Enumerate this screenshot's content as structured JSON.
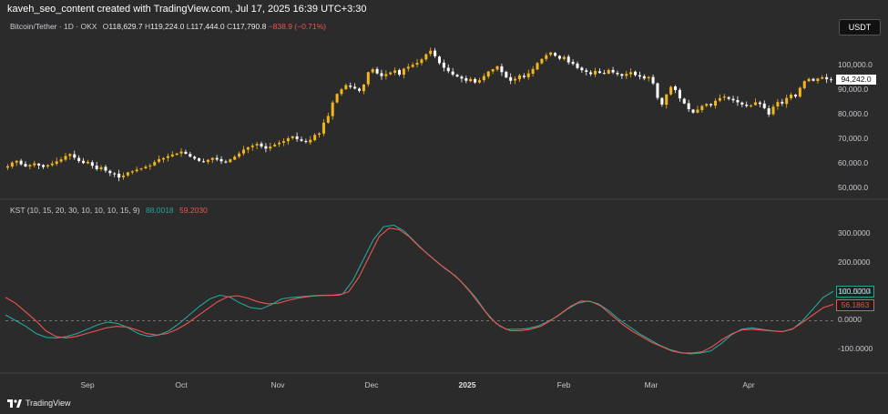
{
  "header": {
    "credit": "kaveh_seo_content created with TradingView.com, Jul 17, 2025 16:39 UTC+3:30",
    "symbol": "Bitcoin/Tether · 1D · OKX",
    "o_label": "O",
    "o_value": "118,629.7",
    "h_label": "H",
    "h_value": "119,224.0",
    "l_label": "L",
    "l_value": "117,444.0",
    "c_label": "C",
    "c_value": "117,790.8",
    "change": "−838.9 (−0.71%)",
    "currency": "USDT"
  },
  "kst": {
    "label": "KST (10, 15, 20, 30, 10, 10, 10, 15, 9)",
    "value1": "88.0018",
    "value2": "59.2030"
  },
  "footer": {
    "brand": "TradingView"
  },
  "colors": {
    "up": "#f2b51d",
    "down": "#ffffff",
    "kst": "#26a69a",
    "signal": "#ef5350",
    "background": "#2b2b2b"
  },
  "chart_data": [
    {
      "type": "candlestick",
      "ylim": [
        47000,
        112000
      ],
      "y_ticks": [
        "100,000.0",
        "90,000.0",
        "80,000.0",
        "70,000.0",
        "60,000.0",
        "50,000.0"
      ],
      "last_price_label": "94,242.0",
      "x_ticks": [
        "Sep",
        "Oct",
        "Nov",
        "Dec",
        "2025",
        "Feb",
        "Mar",
        "Apr"
      ],
      "closes": [
        59000,
        60500,
        61200,
        59800,
        58900,
        59500,
        60200,
        59300,
        58700,
        59400,
        60100,
        61000,
        61800,
        63200,
        64000,
        62500,
        61100,
        60300,
        60800,
        59200,
        57800,
        58600,
        57200,
        56200,
        55800,
        54400,
        55200,
        56500,
        56900,
        57600,
        58100,
        58800,
        59300,
        60700,
        61900,
        62300,
        63100,
        63800,
        64200,
        65000,
        64100,
        62900,
        62100,
        61200,
        60800,
        61600,
        62400,
        61700,
        61000,
        60500,
        61800,
        62900,
        64200,
        65800,
        66700,
        67400,
        68100,
        67100,
        66200,
        67000,
        67800,
        68600,
        69200,
        70400,
        71200,
        70100,
        69400,
        68900,
        69800,
        71800,
        72400,
        76800,
        79500,
        85000,
        88500,
        90400,
        92100,
        91400,
        90700,
        89800,
        92300,
        97400,
        98600,
        96900,
        95800,
        96600,
        97300,
        98100,
        96400,
        98800,
        99600,
        100400,
        101200,
        102600,
        104700,
        106200,
        103900,
        101100,
        99200,
        97800,
        96400,
        95600,
        94800,
        93900,
        94600,
        93200,
        94100,
        95800,
        97700,
        98600,
        99800,
        97400,
        95200,
        93900,
        94700,
        96100,
        95400,
        96900,
        98700,
        101100,
        102800,
        104300,
        105400,
        104100,
        102900,
        103600,
        101400,
        100800,
        99100,
        98200,
        97500,
        96600,
        97900,
        97100,
        96800,
        98300,
        97300,
        96600,
        95900,
        96700,
        97400,
        96200,
        95600,
        94800,
        95400,
        92800,
        86900,
        84200,
        88300,
        91400,
        90100,
        86700,
        84600,
        82300,
        80900,
        82100,
        83600,
        84400,
        83900,
        85700,
        86800,
        87400,
        86500,
        85900,
        85100,
        84200,
        83600,
        83800,
        85100,
        84400,
        82700,
        80100,
        83300,
        85200,
        84600,
        86900,
        88200,
        87500,
        91000,
        93700,
        94600,
        93900,
        94800,
        95300,
        94500,
        94242
      ],
      "currency": "USDT"
    },
    {
      "type": "line",
      "ylim": [
        -150,
        360
      ],
      "y_ticks": [
        "300.0000",
        "200.0000",
        "100.0000",
        "0.0000",
        "-100.0000"
      ],
      "zero_line": true,
      "series": [
        {
          "name": "KST",
          "color": "#26a69a",
          "last_label": "101.5214",
          "values": [
            20,
            0,
            -20,
            -45,
            -58,
            -60,
            -55,
            -45,
            -30,
            -15,
            -5,
            -10,
            -25,
            -45,
            -55,
            -50,
            -35,
            -10,
            20,
            50,
            75,
            88,
            80,
            60,
            45,
            40,
            55,
            75,
            80,
            83,
            86,
            88,
            88,
            92,
            140,
            210,
            280,
            325,
            330,
            310,
            275,
            240,
            210,
            180,
            155,
            120,
            80,
            30,
            -10,
            -30,
            -30,
            -28,
            -20,
            -5,
            15,
            40,
            60,
            68,
            58,
            35,
            5,
            -20,
            -45,
            -65,
            -85,
            -100,
            -110,
            -115,
            -112,
            -105,
            -80,
            -50,
            -30,
            -25,
            -30,
            -35,
            -38,
            -30,
            0,
            40,
            80,
            101.52
          ]
        },
        {
          "name": "Signal",
          "color": "#ef5350",
          "last_label": "56.1863",
          "values": [
            80,
            60,
            30,
            0,
            -35,
            -55,
            -60,
            -55,
            -45,
            -35,
            -25,
            -20,
            -22,
            -32,
            -45,
            -50,
            -45,
            -30,
            -10,
            15,
            40,
            65,
            82,
            86,
            78,
            65,
            58,
            60,
            70,
            78,
            83,
            86,
            87,
            88,
            100,
            150,
            220,
            290,
            320,
            315,
            290,
            255,
            225,
            195,
            170,
            140,
            100,
            55,
            10,
            -20,
            -35,
            -35,
            -30,
            -20,
            0,
            25,
            50,
            68,
            66,
            50,
            20,
            -10,
            -35,
            -55,
            -75,
            -90,
            -105,
            -112,
            -112,
            -108,
            -90,
            -65,
            -45,
            -32,
            -30,
            -33,
            -36,
            -38,
            -28,
            -5,
            20,
            45,
            56.19
          ]
        }
      ]
    }
  ]
}
